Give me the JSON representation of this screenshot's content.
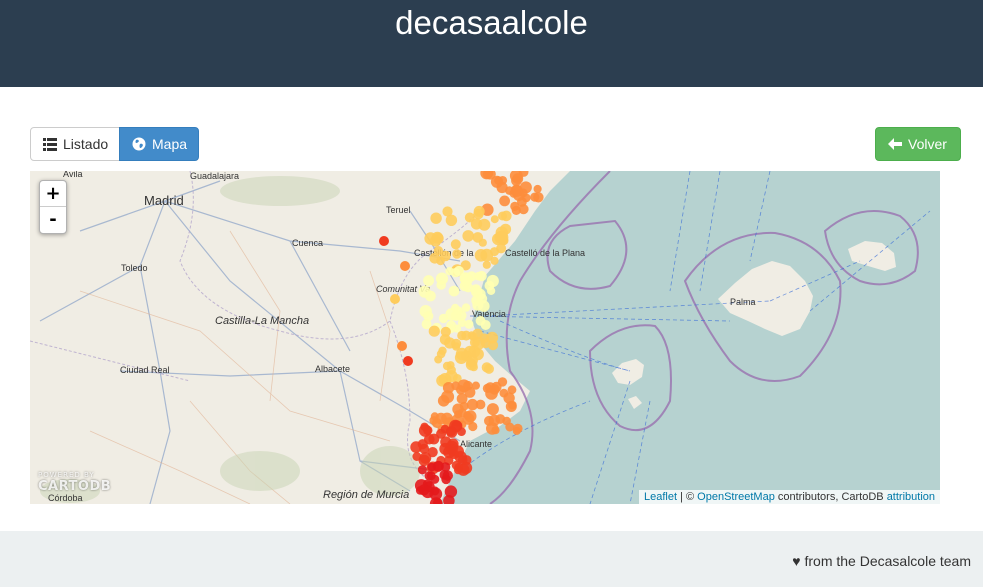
{
  "header": {
    "title": "decasaalcole"
  },
  "toolbar": {
    "listado_label": "Listado",
    "mapa_label": "Mapa",
    "volver_label": "Volver",
    "listado_icon": "list-icon",
    "mapa_icon": "globe-icon",
    "volver_icon": "arrow-left-icon"
  },
  "map": {
    "zoom_in": "+",
    "zoom_out": "-",
    "places": {
      "avila": "Ávila",
      "guadalajara": "Guadalajara",
      "madrid": "Madrid",
      "teruel": "Teruel",
      "cuenca": "Cuenca",
      "toledo": "Toledo",
      "castellon": "Castellón de la",
      "castello": "Castelló de la Plana",
      "comunitat": "Comunitat Va",
      "valencia": "València",
      "castilla": "Castilla-La Mancha",
      "palma": "Palma",
      "ciudad_real": "Ciudad Real",
      "albacete": "Albacete",
      "alicante": "Alicante",
      "murcia": "Región de Murcia",
      "cordoba": "Córdoba"
    },
    "powered_by": "POWERED BY",
    "cartodb_logo": "CARTODB",
    "attribution": {
      "leaflet": "Leaflet",
      "sep": " | © ",
      "osm": "OpenStreetMap",
      "contrib": " contributors, CartoDB ",
      "attribution_link": "attribution"
    },
    "colors": {
      "water": "#b6d2d0",
      "land": "#f0ede4",
      "boundary": "#9a72b0",
      "high": "#ffffb2",
      "mid_high": "#fecc5c",
      "mid": "#fd8d3c",
      "mid_low": "#f03b20",
      "low": "#e31a1c"
    }
  },
  "footer": {
    "credit": "♥ from the Decasalcole team"
  }
}
